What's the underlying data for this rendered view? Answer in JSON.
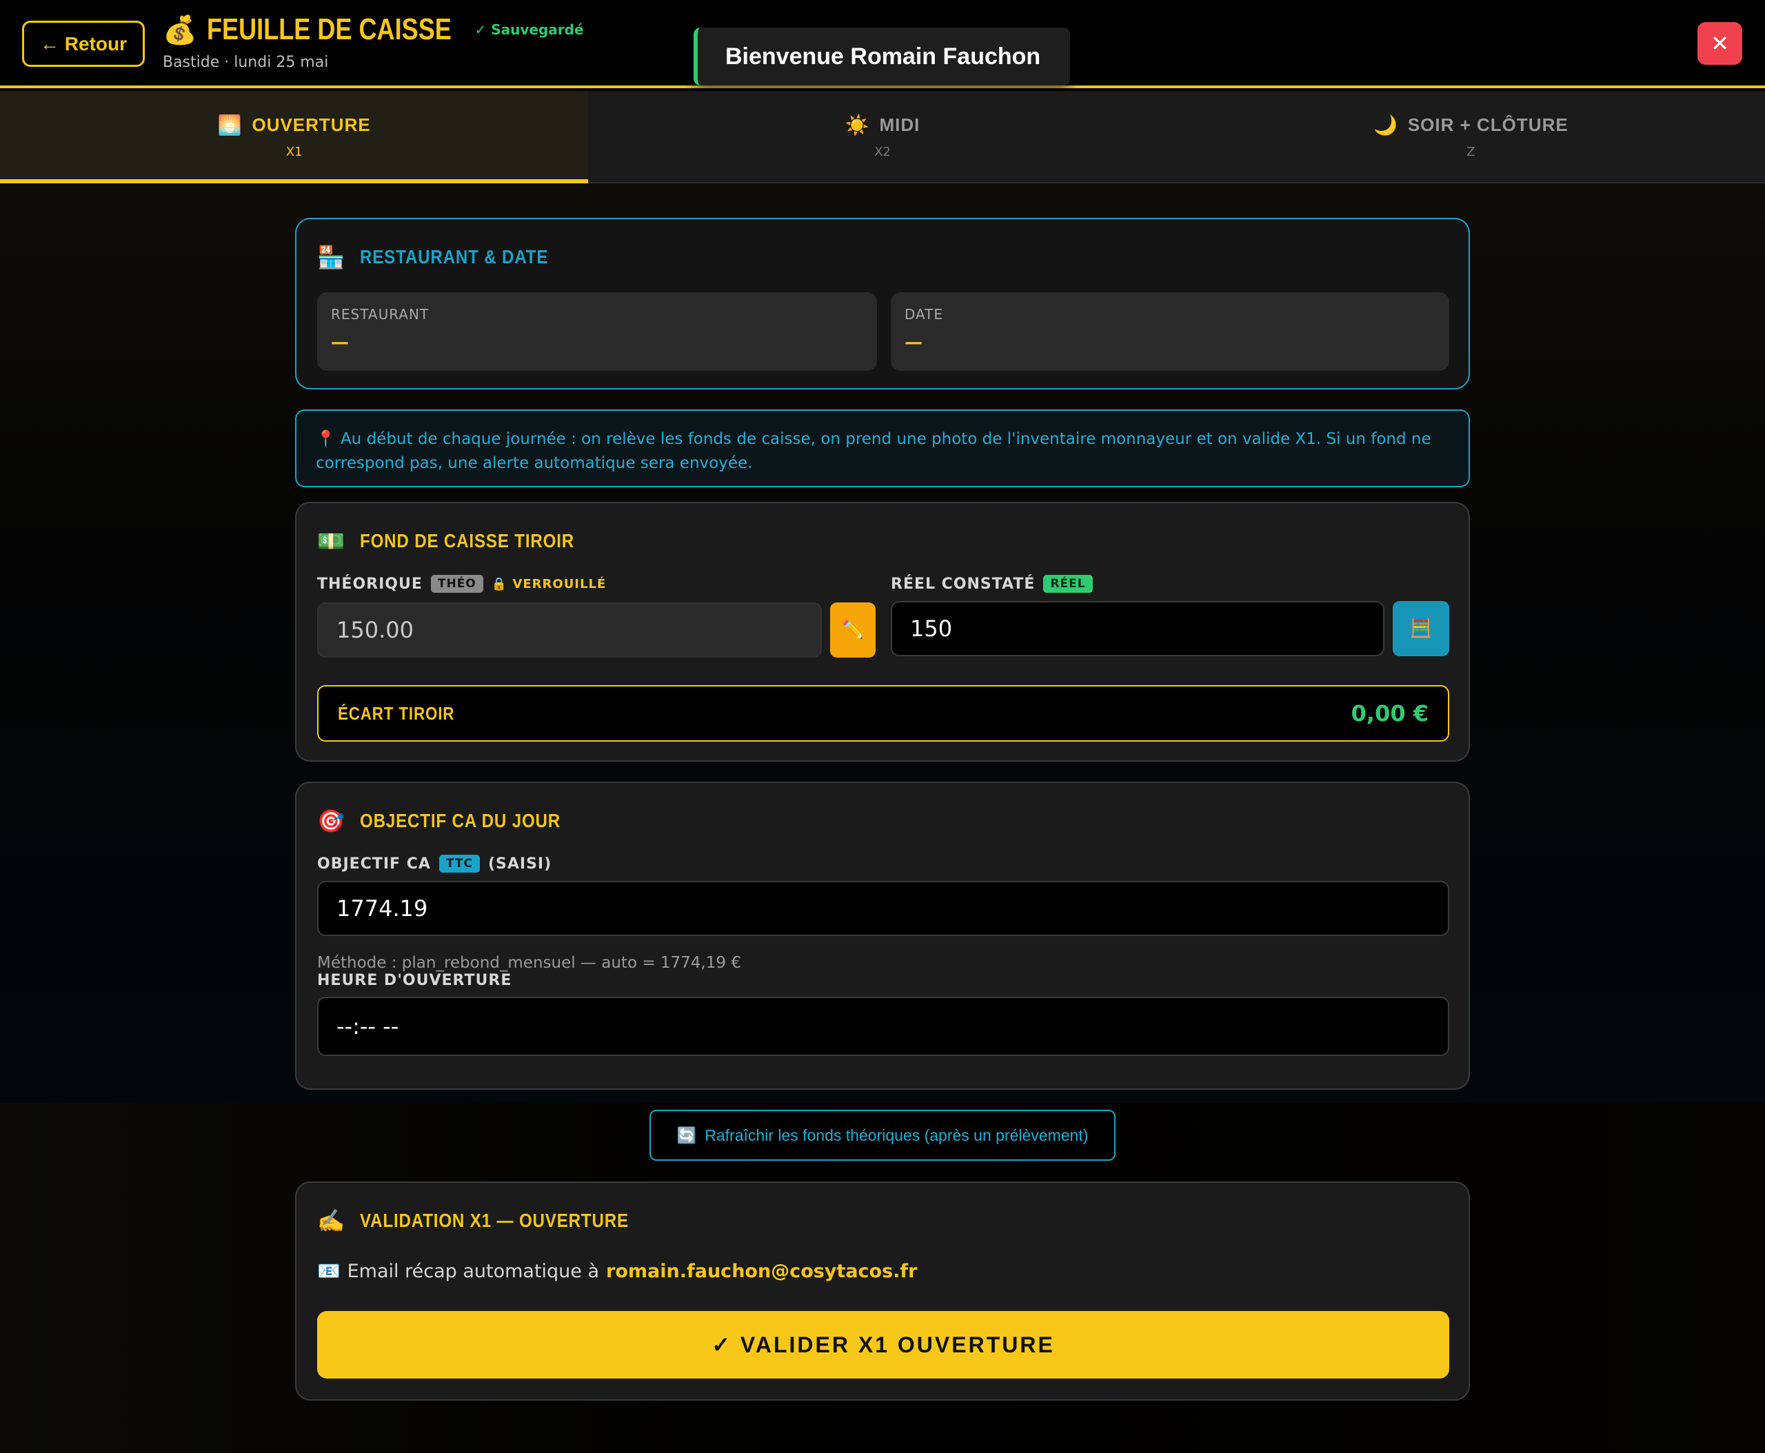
{
  "header": {
    "back_label": "← Retour",
    "money_icon": "💰",
    "title": "FEUILLE DE CAISSE",
    "saved_label": "✓ Sauvegardé",
    "subtitle": "Bastide · lundi 25 mai",
    "close_glyph": "✕"
  },
  "toast": {
    "message": "Bienvenue Romain Fauchon"
  },
  "tabs": [
    {
      "icon": "🌅",
      "label": "OUVERTURE",
      "sub": "X1",
      "active": true
    },
    {
      "icon": "☀️",
      "label": "MIDI",
      "sub": "X2",
      "active": false
    },
    {
      "icon": "🌙",
      "label": "SOIR + CLÔTURE",
      "sub": "Z",
      "active": false
    }
  ],
  "restaurant_card": {
    "icon": "🏪",
    "title": "RESTAURANT & DATE",
    "restaurant_label": "RESTAURANT",
    "restaurant_value": "—",
    "date_label": "DATE",
    "date_value": "—"
  },
  "info": {
    "icon": "📍",
    "text": "Au début de chaque journée : on relève les fonds de caisse, on prend une photo de l'inventaire monnayeur et on valide X1. Si un fond ne correspond pas, une alerte automatique sera envoyée."
  },
  "fond_card": {
    "icon": "💵",
    "title": "FOND DE CAISSE TIROIR",
    "theo_label": "THÉORIQUE",
    "theo_badge": "THÉO",
    "locked_label": "🔒 VERROUILLÉ",
    "theo_value": "150.00",
    "edit_icon": "✏️",
    "reel_label": "RÉEL CONSTATÉ",
    "reel_badge": "RÉEL",
    "reel_value": "150",
    "calc_icon": "🧮",
    "ecart_label": "ÉCART TIROIR",
    "ecart_value": "0,00 €"
  },
  "objectif_card": {
    "icon": "🎯",
    "title": "OBJECTIF CA DU JOUR",
    "ca_label": "OBJECTIF CA",
    "ca_badge": "TTC",
    "ca_suffix": "(SAISI)",
    "ca_value": "1774.19",
    "method_text": "Méthode : plan_rebond_mensuel — auto = 1774,19 €",
    "heure_label": "HEURE D'OUVERTURE",
    "heure_value": "--:-- --"
  },
  "refresh": {
    "icon": "🔄",
    "label": "Rafraîchir les fonds théoriques (après un prélèvement)"
  },
  "validation_card": {
    "icon": "✍️",
    "title": "VALIDATION X1 — OUVERTURE",
    "email_icon": "📧",
    "email_prefix": "Email récap automatique à",
    "email_address": "romain.fauchon@cosytacos.fr",
    "validate_label": "✓ VALIDER X1 OUVERTURE"
  },
  "colors": {
    "accent": "#f6c619",
    "cyan": "#1aa3c8",
    "success": "#2ecc71",
    "danger": "#f0414f"
  }
}
